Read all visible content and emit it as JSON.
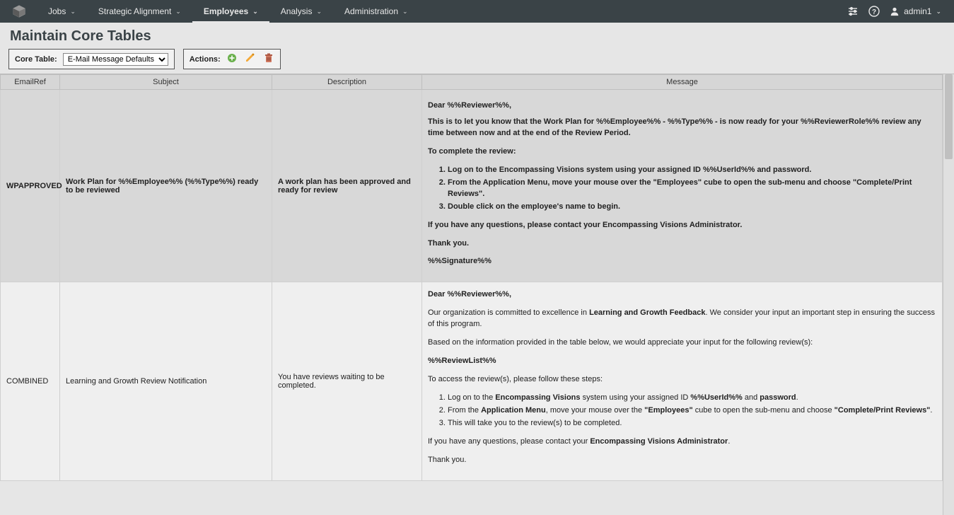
{
  "nav": {
    "items": [
      {
        "label": "Jobs"
      },
      {
        "label": "Strategic Alignment"
      },
      {
        "label": "Employees"
      },
      {
        "label": "Analysis"
      },
      {
        "label": "Administration"
      }
    ],
    "active_index": 2,
    "user": "admin1"
  },
  "page": {
    "title": "Maintain Core Tables"
  },
  "toolbar": {
    "core_table_label": "Core Table:",
    "core_table_value": "E-Mail Message Defaults",
    "actions_label": "Actions:"
  },
  "table": {
    "headers": {
      "ref": "EmailRef",
      "subject": "Subject",
      "description": "Description",
      "message": "Message"
    },
    "rows": [
      {
        "ref": "WPAPPROVED",
        "subject": "Work Plan for %%Employee%% (%%Type%%) ready to be reviewed",
        "description": "A work plan has been approved and ready for review",
        "msg": {
          "greeting": "Dear %%Reviewer%%,",
          "intro": "This is to let you know that the Work Plan for %%Employee%% - %%Type%% - is now ready for your %%ReviewerRole%% review any time between now and at the end of the Review Period.",
          "steps_title": "To complete the review:",
          "steps": [
            "Log on to the Encompassing Visions system using your assigned ID %%UserId%% and password.",
            "From the Application Menu, move your mouse over the \"Employees\" cube to open the sub-menu and choose \"Complete/Print Reviews\".",
            "Double click on the employee's name to begin."
          ],
          "closing1": "If you have any questions, please contact your Encompassing Visions Administrator.",
          "closing2": "Thank you.",
          "signature": "%%Signature%%"
        }
      },
      {
        "ref": "COMBINED",
        "subject": "Learning and Growth Review Notification",
        "description": "You have reviews waiting to be completed.",
        "msg": {
          "greeting": "Dear %%Reviewer%%,",
          "intro_pre": "Our organization is committed to excellence in ",
          "intro_bold": "Learning and Growth Feedback",
          "intro_post": ". We consider your input an important step in ensuring the success of this program.",
          "based": "Based on the information provided in the table below, we would appreciate your input for the following review(s):",
          "reviewlist": "%%ReviewList%%",
          "steps_title": "To access the review(s), please follow these steps:",
          "steps_html": [
            {
              "pre": "Log on to the ",
              "b": "Encompassing Visions",
              "mid": " system using your assigned ID ",
              "b2": "%%UserId%%",
              "mid2": " and ",
              "b3": "password",
              "post": "."
            },
            {
              "pre": "From the ",
              "b": "Application Menu",
              "mid": ", move your mouse over the ",
              "b2": "\"Employees\"",
              "mid2": " cube to open the sub-menu and choose ",
              "b3": "\"Complete/Print Reviews\"",
              "post": "."
            },
            {
              "pre": "This will take you to the review(s) to be completed.",
              "b": "",
              "mid": "",
              "b2": "",
              "mid2": "",
              "b3": "",
              "post": ""
            }
          ],
          "closing_pre": "If you have any questions, please contact your ",
          "closing_b": "Encompassing Visions Administrator",
          "closing_post": ".",
          "thanks": "Thank you."
        }
      }
    ]
  }
}
